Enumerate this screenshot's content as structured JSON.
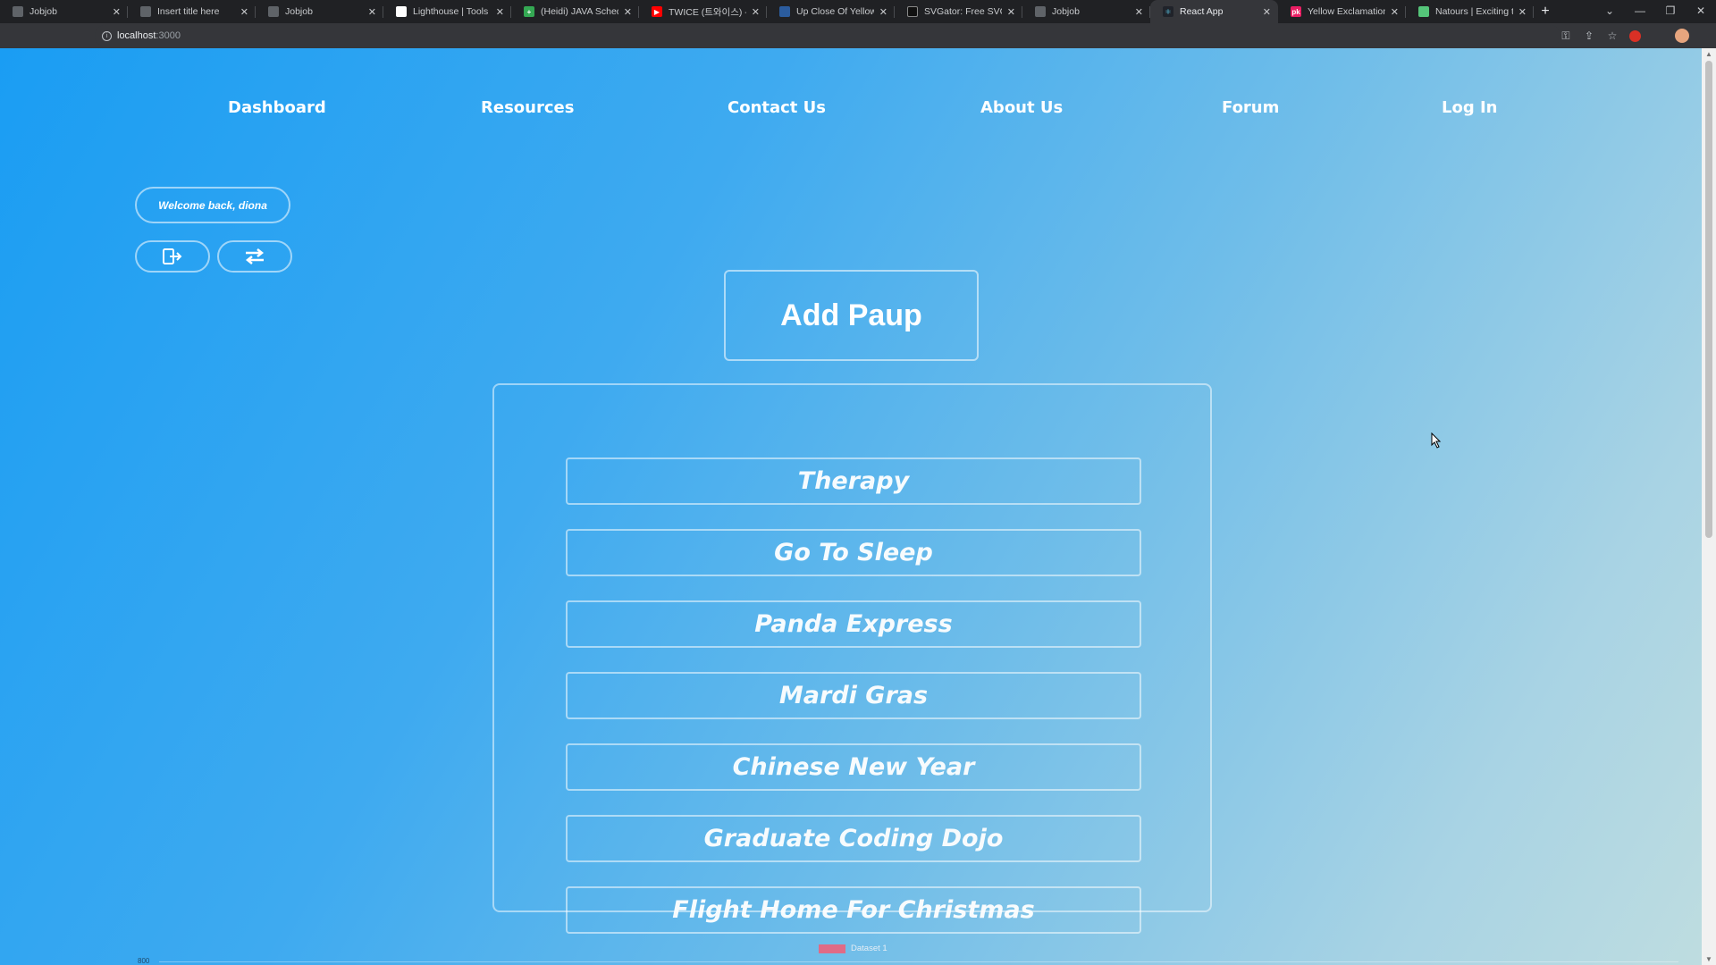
{
  "browser": {
    "tabs": [
      {
        "title": "Jobjob",
        "favicon_color": "#5f6368",
        "active": false
      },
      {
        "title": "Insert title here",
        "favicon_color": "#5f6368",
        "active": false
      },
      {
        "title": "Jobjob",
        "favicon_color": "#5f6368",
        "active": false
      },
      {
        "title": "Lighthouse | Tools for",
        "favicon_color": "#ffffff",
        "active": false
      },
      {
        "title": "(Heidi) JAVA Schedule",
        "favicon_color": "#34a853",
        "active": false
      },
      {
        "title": "TWICE (트와이스) - SIG",
        "favicon_color": "#ff0000",
        "active": false
      },
      {
        "title": "Up Close Of Yellow Rub",
        "favicon_color": "#2b5c9e",
        "active": false
      },
      {
        "title": "SVGator: Free SVG Anim",
        "favicon_color": "#111111",
        "active": false
      },
      {
        "title": "Jobjob",
        "favicon_color": "#5f6368",
        "active": false
      },
      {
        "title": "React App",
        "favicon_color": "#61dafb",
        "active": true
      },
      {
        "title": "Yellow Exclamation Png",
        "favicon_color": "#e91e63",
        "active": false
      },
      {
        "title": "Natours | Exciting tours",
        "favicon_color": "#55c57a",
        "active": false
      }
    ],
    "url_host": "localhost",
    "url_port": ":3000"
  },
  "nav": {
    "items": [
      "Dashboard",
      "Resources",
      "Contact Us",
      "About Us",
      "Forum",
      "Log In"
    ]
  },
  "user": {
    "welcome": "Welcome back, diona"
  },
  "main": {
    "add_button": "Add Paup",
    "paups": [
      "Therapy",
      "Go To Sleep",
      "Panda Express",
      "Mardi Gras",
      "Chinese New Year",
      "Graduate Coding Dojo",
      "Flight Home For Christmas"
    ]
  },
  "chart": {
    "legend": "Dataset 1",
    "legend_color": "#e06b86",
    "y_tick": "800"
  },
  "colors": {
    "bg_start": "#1a9df3",
    "bg_end": "#bfdde0"
  }
}
